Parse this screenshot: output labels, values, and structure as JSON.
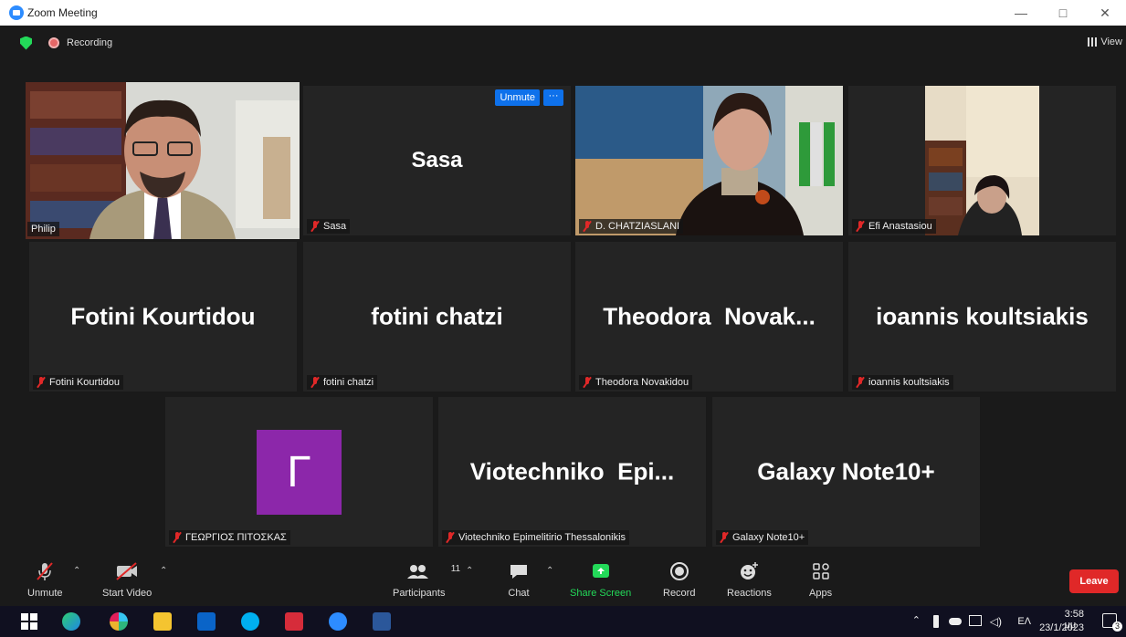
{
  "window": {
    "title": "Zoom Meeting",
    "controls": [
      "—",
      "□",
      "✕"
    ]
  },
  "topbar": {
    "recording_label": "Recording",
    "view_label": "View"
  },
  "participants_tiles": [
    {
      "name": "Philip",
      "type": "video"
    },
    {
      "name": "Sasa",
      "big_name": "Sasa",
      "type": "name"
    },
    {
      "name": "D. CHATZIASLANI",
      "type": "video"
    },
    {
      "name": "Efi Anastasiou",
      "type": "video"
    },
    {
      "name": "Fotini Kourtidou",
      "big_name": "Fotini Kourtidou",
      "type": "name"
    },
    {
      "name": "fotini chatzi",
      "big_name": "fotini chatzi",
      "type": "name"
    },
    {
      "name": "Theodora Novakidou",
      "big_name": "Theodora  Novak...",
      "type": "name"
    },
    {
      "name": "ioannis koultsiakis",
      "big_name": "ioannis koultsiakis",
      "type": "name"
    },
    {
      "name": "ΓΕΩΡΓΙΟΣ ΠΙΤΟΣΚΑΣ",
      "avatar_letter": "Γ",
      "type": "avatar"
    },
    {
      "name": "Viotechniko Epimelitirio Thessalonikis",
      "big_name": "Viotechniko  Epi...",
      "type": "name"
    },
    {
      "name": "Galaxy Note10+",
      "big_name": "Galaxy Note10+",
      "type": "name"
    }
  ],
  "hover_controls": {
    "unmute_label": "Unmute",
    "more_label": "···"
  },
  "toolbar": {
    "unmute_label": "Unmute",
    "start_video_label": "Start Video",
    "participants_label": "Participants",
    "participants_count": "11",
    "chat_label": "Chat",
    "share_label": "Share Screen",
    "record_label": "Record",
    "reactions_label": "Reactions",
    "apps_label": "Apps",
    "leave_label": "Leave",
    "share_color": "#23d959"
  },
  "taskbar": {
    "language": "ΕΛ",
    "time": "3:58 μμ",
    "date": "23/1/2023",
    "notifications": "3"
  }
}
